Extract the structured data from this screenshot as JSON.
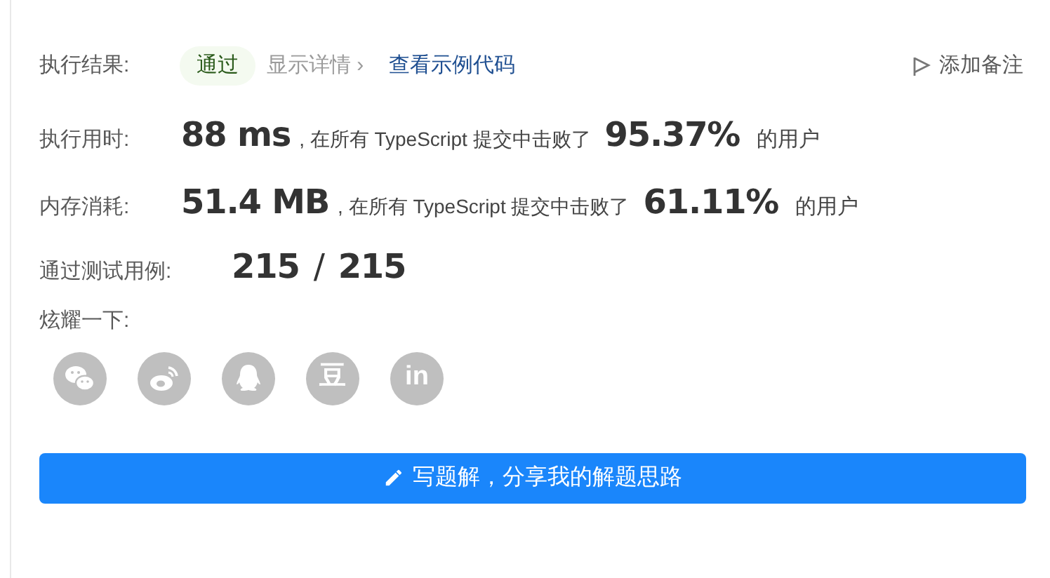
{
  "result": {
    "label": "执行结果:",
    "status": "通过",
    "details_link": "显示详情",
    "details_arrow": "›",
    "sample_code_link": "查看示例代码",
    "add_note": "添加备注"
  },
  "stats": [
    {
      "label": "执行用时:",
      "value": "88 ms",
      "middle": ", 在所有 TypeScript 提交中击败了",
      "percent": "95.37%",
      "suffix": "的用户"
    },
    {
      "label": "内存消耗:",
      "value": "51.4 MB",
      "middle": ", 在所有 TypeScript 提交中击败了",
      "percent": "61.11%",
      "suffix": "的用户"
    }
  ],
  "tests": {
    "label": "通过测试用例:",
    "passed": "215",
    "separator": "/",
    "total": "215"
  },
  "share": {
    "label": "炫耀一下:",
    "items": [
      {
        "kind": "wechat"
      },
      {
        "kind": "weibo"
      },
      {
        "kind": "qq"
      },
      {
        "kind": "glyph",
        "text": "豆"
      },
      {
        "kind": "glyph",
        "text": "in"
      }
    ]
  },
  "write_button": "写题解，分享我的解题思路"
}
